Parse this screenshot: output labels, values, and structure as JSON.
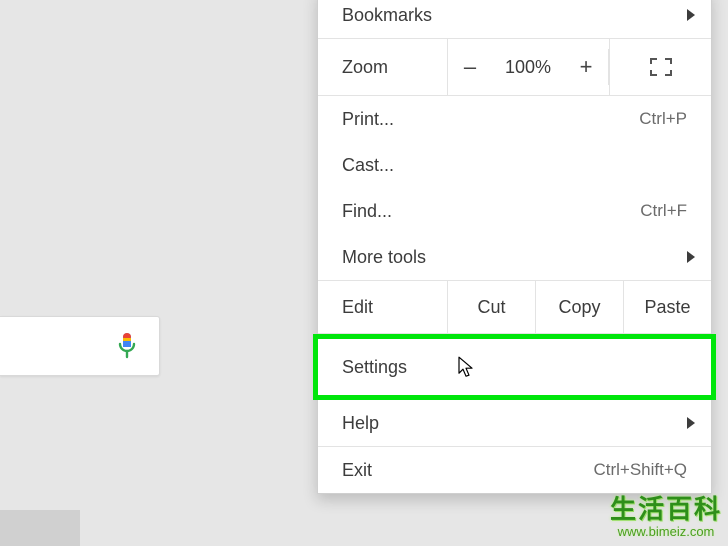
{
  "menu": {
    "bookmarks": "Bookmarks",
    "zoom": {
      "label": "Zoom",
      "minus": "–",
      "value": "100%",
      "plus": "+"
    },
    "print": {
      "label": "Print...",
      "shortcut": "Ctrl+P"
    },
    "cast": "Cast...",
    "find": {
      "label": "Find...",
      "shortcut": "Ctrl+F"
    },
    "more_tools": "More tools",
    "edit": {
      "label": "Edit",
      "cut": "Cut",
      "copy": "Copy",
      "paste": "Paste"
    },
    "settings": "Settings",
    "help": "Help",
    "exit": {
      "label": "Exit",
      "shortcut": "Ctrl+Shift+Q"
    }
  },
  "highlight_color": "#00e60b",
  "watermark": {
    "title_cn": "生活百科",
    "url": "www.bimeiz.com"
  }
}
